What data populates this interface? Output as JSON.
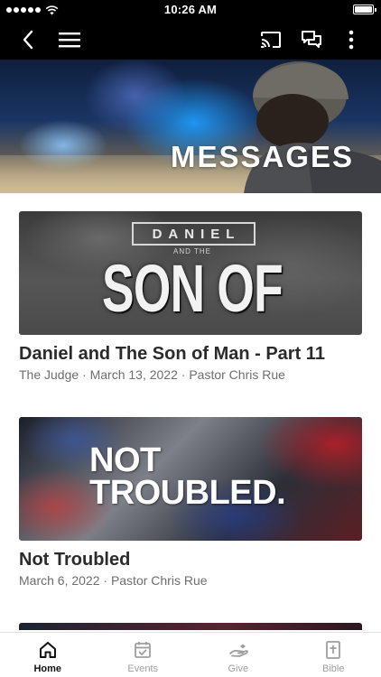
{
  "status_bar": {
    "time": "10:26 AM"
  },
  "app_bar": {
    "back_icon": "chevron-left-icon",
    "menu_icon": "hamburger-menu-icon",
    "cast_icon": "cast-icon",
    "chat_icon": "chat-bubbles-icon",
    "more_icon": "more-vertical-icon"
  },
  "hero": {
    "title": "MESSAGES"
  },
  "messages": [
    {
      "artwork_text": {
        "top": "DANIEL",
        "middle": "AND THE",
        "main": "SON OF MAN"
      },
      "title": "Daniel  and The Son of Man - Part 11",
      "subtitle": "The Judge · March 13, 2022 · Pastor Chris Rue"
    },
    {
      "artwork_text": {
        "line1": "NOT",
        "line2": "TROUBLED."
      },
      "title": "Not Troubled",
      "subtitle": "March 6, 2022 · Pastor Chris Rue"
    }
  ],
  "tabs": [
    {
      "label": "Home",
      "icon": "home-icon",
      "active": true
    },
    {
      "label": "Events",
      "icon": "calendar-check-icon",
      "active": false
    },
    {
      "label": "Give",
      "icon": "give-hand-icon",
      "active": false
    },
    {
      "label": "Bible",
      "icon": "bible-icon",
      "active": false
    }
  ],
  "colors": {
    "bar": "#000000",
    "title_text": "#2b2b2b",
    "subtitle_text": "#6e6e6e",
    "tab_inactive": "#9e9e9e",
    "tab_active": "#111111"
  }
}
